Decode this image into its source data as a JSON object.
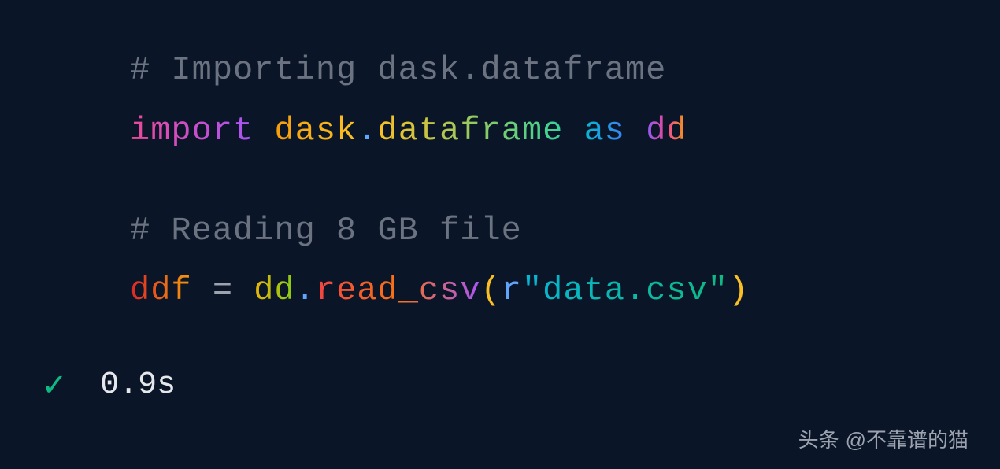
{
  "code": {
    "line1_comment": "# Importing dask.dataframe",
    "line2_import": "import",
    "line2_module1": "dask",
    "line2_dot": ".",
    "line2_module2": "dataframe",
    "line2_as": "as",
    "line2_alias": "dd",
    "line3_comment": "# Reading 8 GB file",
    "line4_var": "ddf",
    "line4_equals": " = ",
    "line4_obj": "dd",
    "line4_dot": ".",
    "line4_func": "read_csv",
    "line4_paren_open": "(",
    "line4_r": "r",
    "line4_string": "\"data.csv\"",
    "line4_paren_close": ")"
  },
  "status": {
    "checkmark": "✓",
    "time": "0.9s"
  },
  "watermark": {
    "prefix": "头条",
    "handle": "@不靠谱的猫"
  }
}
